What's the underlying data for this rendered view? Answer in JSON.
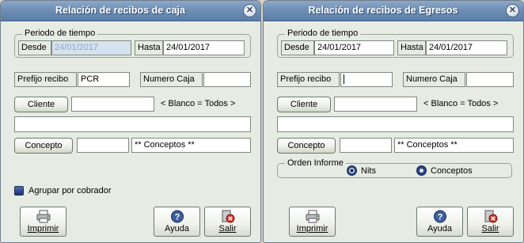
{
  "left": {
    "title": "Relación de recibos de caja",
    "period_legend": "Periodo de tiempo",
    "desde_label": "Desde",
    "desde_value": "24/01/2017",
    "hasta_label": "Hasta",
    "hasta_value": "24/01/2017",
    "prefijo_label": "Prefijo recibo",
    "prefijo_value": "PCR",
    "numero_caja_label": "Numero Caja",
    "numero_caja_value": "",
    "cliente_button": "Cliente",
    "cliente_value": "",
    "blanco_hint": "< Blanco = Todos >",
    "wide_value": "",
    "concepto_button": "Concepto",
    "concepto_value": "",
    "conceptos_text": "**  Conceptos **",
    "agrupar_label": "Agrupar por cobrador",
    "imprimir": "Imprimir",
    "ayuda": "Ayuda",
    "salir": "Salir"
  },
  "right": {
    "title": "Relación de recibos de Egresos",
    "period_legend": "Periodo de tiempo",
    "desde_label": "Desde",
    "desde_value": "24/01/2017",
    "hasta_label": "Hasta",
    "hasta_value": "24/01/2017",
    "prefijo_label": "Prefijo recibo",
    "prefijo_value": "",
    "numero_caja_label": "Numero Caja",
    "numero_caja_value": "",
    "cliente_button": "Cliente",
    "cliente_value": "",
    "blanco_hint": "< Blanco = Todos >",
    "wide_value": "",
    "concepto_button": "Concepto",
    "concepto_value": "",
    "conceptos_text": "**  Conceptos **",
    "orden_legend": "Orden Informe",
    "nits_label": "Nits",
    "conceptos_option": "Conceptos",
    "imprimir": "Imprimir",
    "ayuda": "Ayuda",
    "salir": "Salir"
  },
  "icons": {
    "close": "close-icon",
    "printer": "printer-icon",
    "help": "help-icon",
    "exit": "exit-icon"
  },
  "colors": {
    "titlebar": "#6f8fb5",
    "window_bg": "#e6ebe3",
    "selection": "#d6e2ee"
  }
}
